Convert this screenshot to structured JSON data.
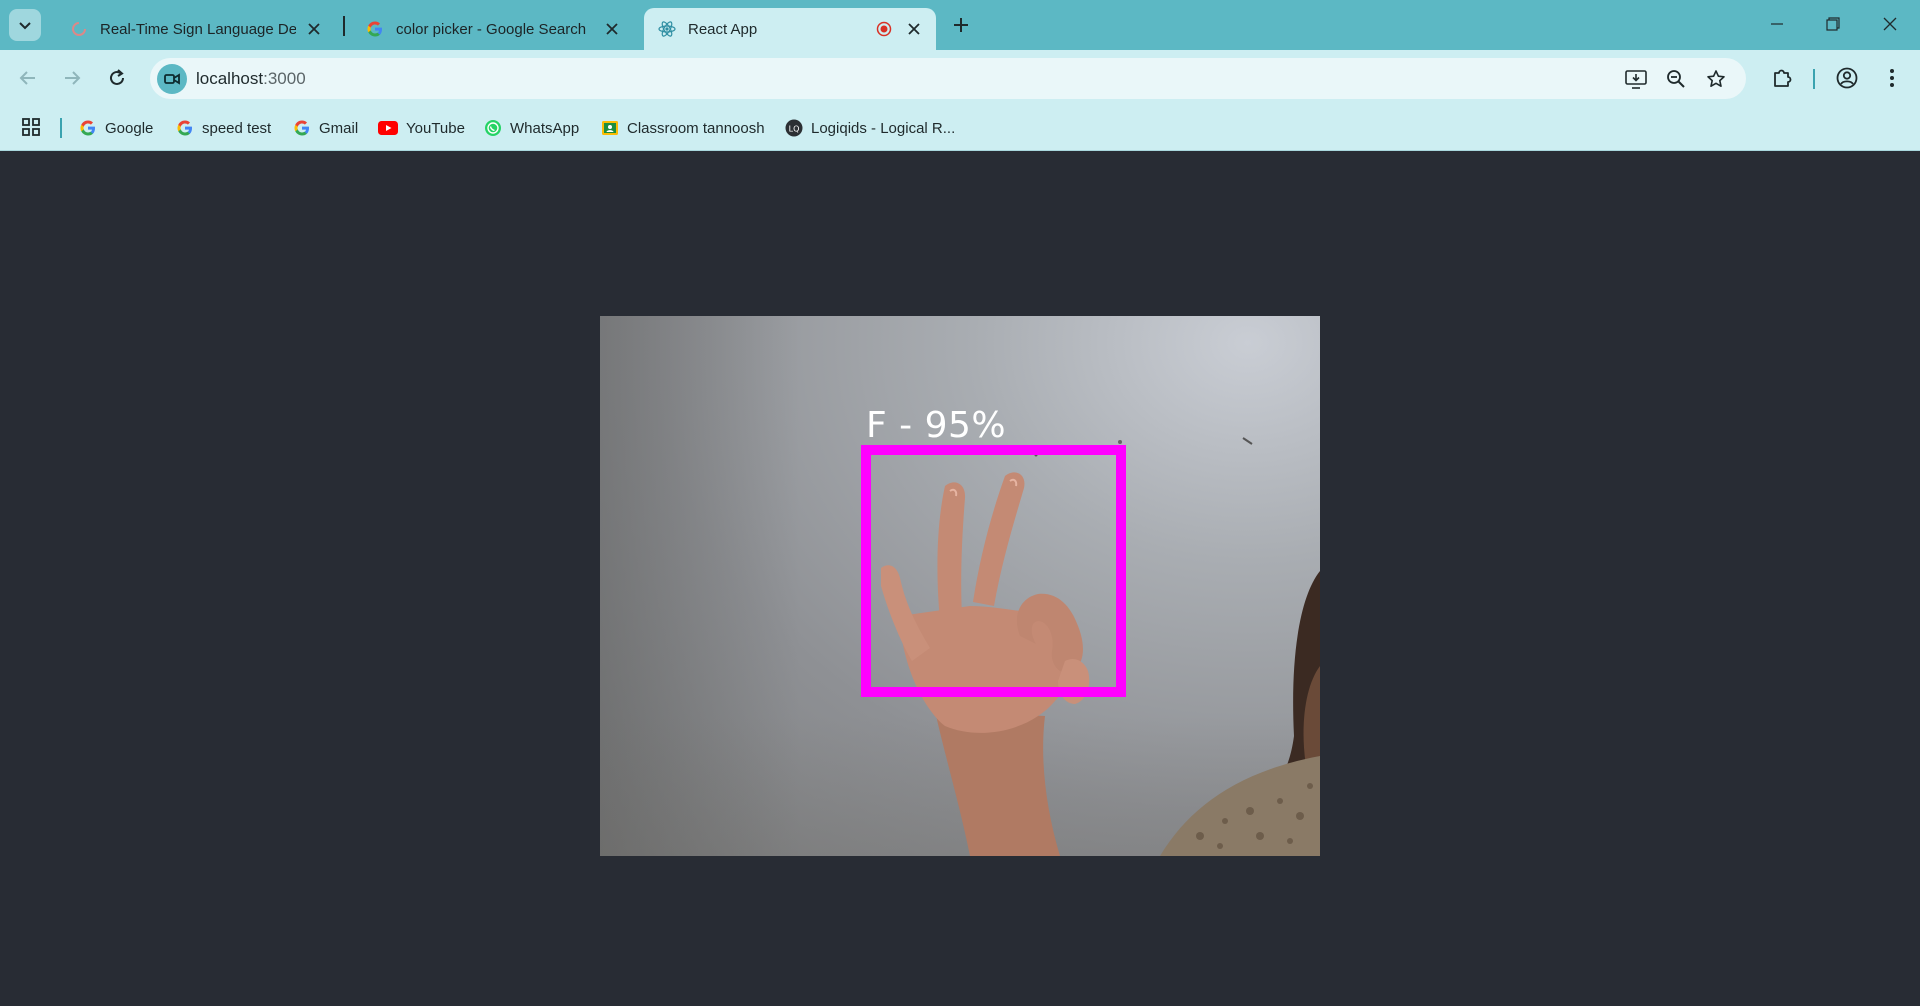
{
  "browser": {
    "tabs": [
      {
        "title": "Real-Time Sign Language Detec",
        "favicon": "ring-favicon-icon",
        "active": false
      },
      {
        "title": "color picker - Google Search",
        "favicon": "google-icon",
        "active": false
      },
      {
        "title": "React App",
        "favicon": "react-icon",
        "active": true,
        "recording": true
      }
    ],
    "address": {
      "host": "localhost",
      "port": ":3000"
    },
    "bookmarks": [
      {
        "label": "Google",
        "icon": "google-icon"
      },
      {
        "label": "speed test",
        "icon": "google-icon"
      },
      {
        "label": "Gmail",
        "icon": "google-icon"
      },
      {
        "label": "YouTube",
        "icon": "youtube-icon"
      },
      {
        "label": "WhatsApp",
        "icon": "whatsapp-icon"
      },
      {
        "label": "Classroom tannoosh",
        "icon": "classroom-icon"
      },
      {
        "label": "Logiqids - Logical R...",
        "icon": "logiqids-icon"
      }
    ]
  },
  "app": {
    "detection": {
      "label": "F - 95%",
      "box_color": "#ff00ff",
      "text_color": "#ffffff"
    },
    "background_color": "#282c34"
  },
  "colors": {
    "tabstrip": "#5cb8c4",
    "toolbar": "#cdeef2",
    "accent": "#3aa3b0"
  }
}
